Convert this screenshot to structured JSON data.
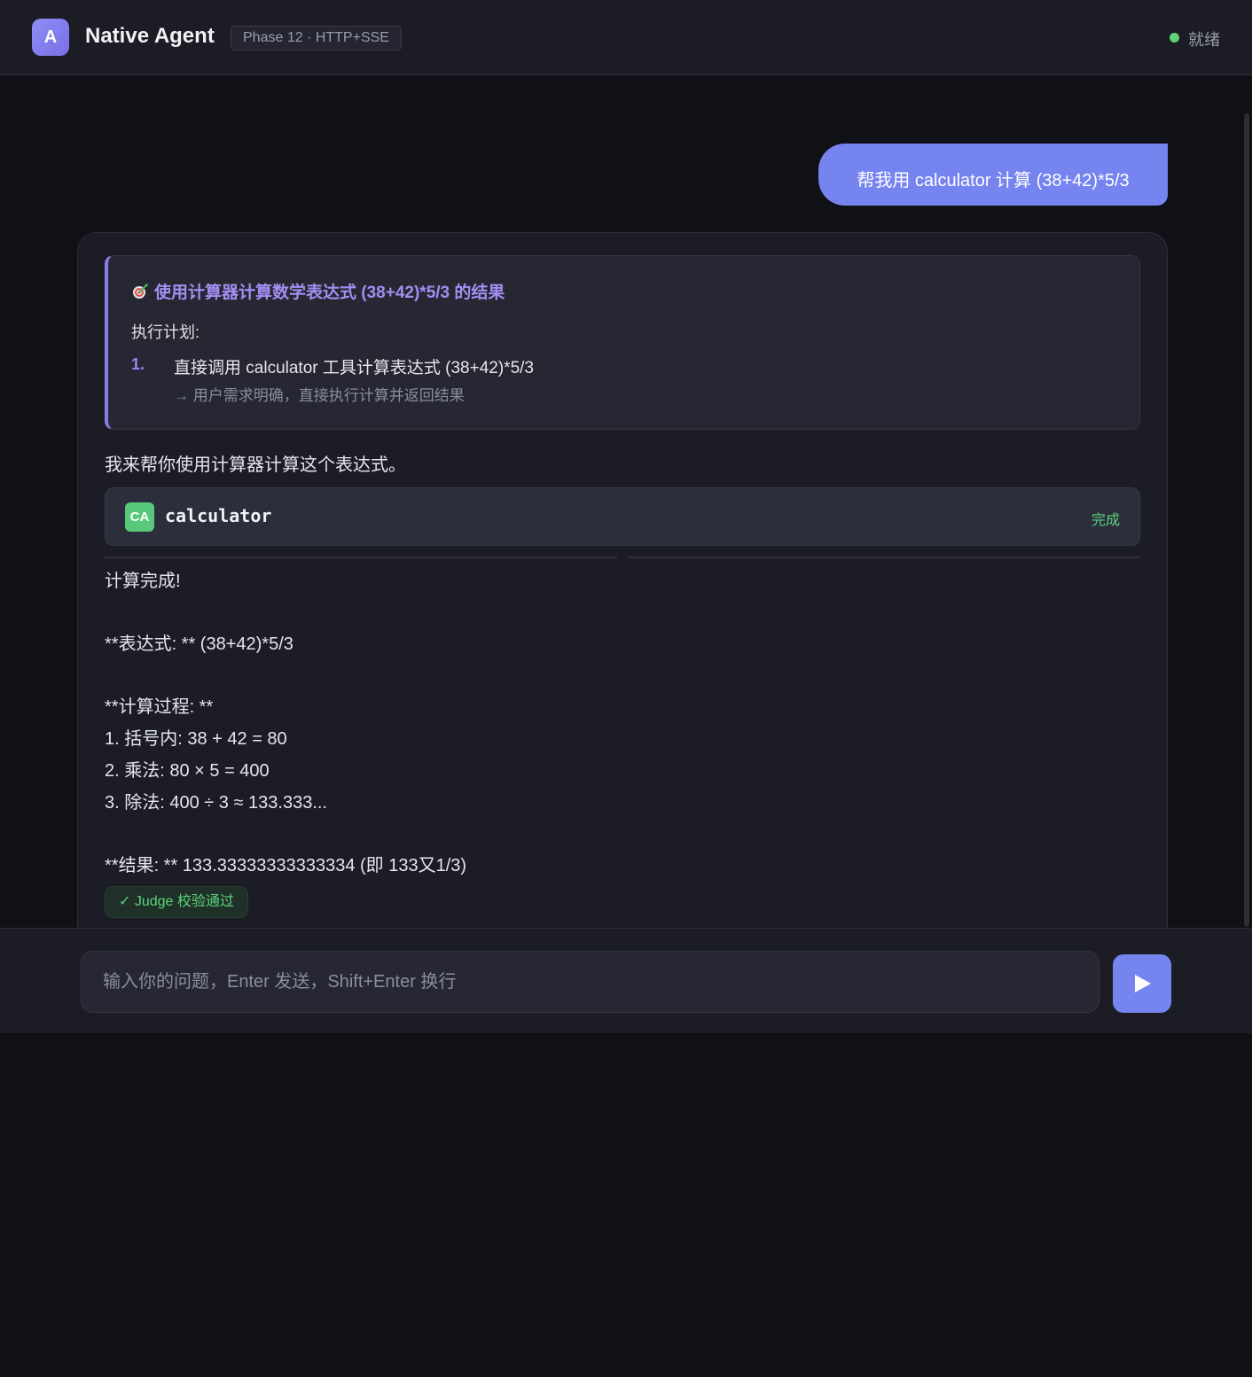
{
  "header": {
    "logo_letter": "A",
    "title": "Native Agent",
    "phase_badge": "Phase 12 · HTTP+SSE",
    "status": "就绪",
    "status_color": "#5dd47a"
  },
  "messages": {
    "user": "帮我用 calculator 计算 (38+42)*5/3",
    "plan": {
      "goal_icon": "target-icon",
      "goal": "使用计算器计算数学表达式 (38+42)*5/3 的结果",
      "heading": "执行计划:",
      "steps": [
        {
          "num": "1.",
          "text": "直接调用 calculator 工具计算表达式 (38+42)*5/3",
          "reason": "→ 用户需求明确，直接执行计算并返回结果"
        }
      ]
    },
    "intro": "我来帮你使用计算器计算这个表达式。",
    "tool": {
      "icon_text": "CA",
      "name": "calculator",
      "status": "完成"
    },
    "result_lines": [
      "计算完成!",
      "**表达式: ** (38+42)*5/3",
      "**计算过程: **",
      "1. 括号内: 38 + 42 = 80",
      "2. 乘法: 80 × 5 = 400",
      "3. 除法: 400 ÷ 3 ≈ 133.333...",
      "**结果: ** 133.33333333333334 (即 133又1/3)"
    ],
    "judge": "✓ Judge 校验通过"
  },
  "input": {
    "placeholder": "输入你的问题，Enter 发送，Shift+Enter 换行",
    "value": ""
  },
  "colors": {
    "accent": "#7684f0",
    "plan_accent": "#8a7be8",
    "success": "#5dd47a"
  }
}
